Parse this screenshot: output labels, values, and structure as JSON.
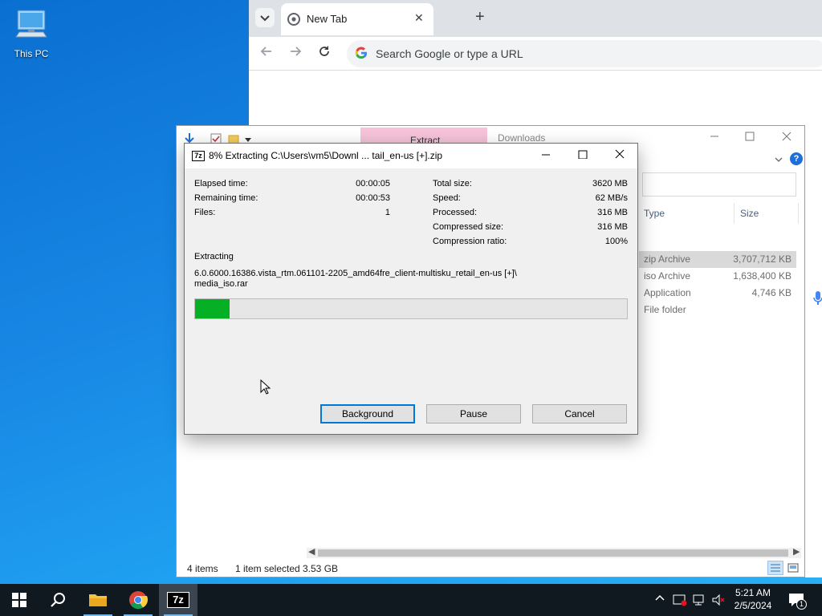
{
  "desktop": {
    "icons": [
      {
        "label": "This PC"
      }
    ]
  },
  "chrome": {
    "tab_title": "New Tab",
    "tab_close": "✕",
    "new_tab": "+",
    "omnibox_placeholder": "Search Google or type a URL"
  },
  "explorer": {
    "extract_tab": "Extract",
    "title": "Downloads",
    "columns": [
      "Type",
      "Size"
    ],
    "rows": [
      {
        "type": "zip Archive",
        "size": "3,707,712 KB",
        "selected": true
      },
      {
        "type": "iso Archive",
        "size": "1,638,400 KB",
        "selected": false
      },
      {
        "type": "Application",
        "size": "4,746 KB",
        "selected": false
      },
      {
        "type": "File folder",
        "size": "",
        "selected": false
      }
    ],
    "status": {
      "items": "4 items",
      "selected": "1 item selected",
      "size": "3.53 GB"
    }
  },
  "dialog": {
    "title": "8% Extracting C:\\Users\\vm5\\Downl ... tail_en-us [+].zip",
    "icon_text": "7z",
    "left_stats": [
      {
        "label": "Elapsed time:",
        "value": "00:00:05"
      },
      {
        "label": "Remaining time:",
        "value": "00:00:53"
      },
      {
        "label": "Files:",
        "value": "1"
      }
    ],
    "right_stats": [
      {
        "label": "Total size:",
        "value": "3620 MB"
      },
      {
        "label": "Speed:",
        "value": "62 MB/s"
      },
      {
        "label": "Processed:",
        "value": "316 MB"
      },
      {
        "label": "Compressed size:",
        "value": "316 MB"
      },
      {
        "label": "Compression ratio:",
        "value": "100%"
      }
    ],
    "action_label": "Extracting",
    "current_file_line1": "6.0.6000.16386.vista_rtm.061101-2205_amd64fre_client-multisku_retail_en-us [+]\\",
    "current_file_line2": "media_iso.rar",
    "progress_fraction": 0.08,
    "buttons": {
      "background": "Background",
      "pause": "Pause",
      "cancel": "Cancel"
    }
  },
  "taskbar": {
    "items": [
      "start",
      "search",
      "file-explorer",
      "chrome",
      "7-zip"
    ],
    "time": "5:21 AM",
    "date": "2/5/2024",
    "notification_count": "1"
  },
  "colors": {
    "progress_fill": "#06b025",
    "taskbar": "#101820",
    "selected_row": "#d9d9d9"
  }
}
